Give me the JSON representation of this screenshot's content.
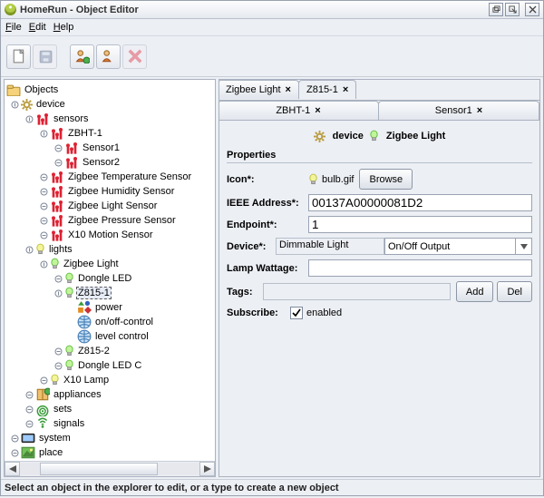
{
  "window": {
    "title": "HomeRun - Object Editor"
  },
  "menu": {
    "file": "File",
    "edit": "Edit",
    "help": "Help"
  },
  "tree": {
    "root": "Objects",
    "device": "device",
    "sensors": "sensors",
    "zbht1": "ZBHT-1",
    "sensor1": "Sensor1",
    "sensor2": "Sensor2",
    "ztemp": "Zigbee Temperature Sensor",
    "zhum": "Zigbee Humidity Sensor",
    "zlight": "Zigbee Light Sensor",
    "zpress": "Zigbee Pressure Sensor",
    "x10motion": "X10 Motion Sensor",
    "lights": "lights",
    "zigbeelight": "Zigbee Light",
    "dongleled": "Dongle LED",
    "z8151": "Z815-1",
    "power": "power",
    "onoff": "on/off-control",
    "level": "level control",
    "z8152": "Z815-2",
    "dongleledc": "Dongle LED C",
    "x10lamp": "X10 Lamp",
    "appliances": "appliances",
    "sets": "sets",
    "signals": "signals",
    "system": "system",
    "place": "place"
  },
  "tabs": {
    "row1": [
      {
        "label": "Zigbee Light",
        "active": false
      },
      {
        "label": "Z815-1",
        "active": true
      }
    ],
    "row2": [
      {
        "label": "ZBHT-1",
        "active": false
      },
      {
        "label": "Sensor1",
        "active": false
      }
    ]
  },
  "crumb": {
    "device": "device",
    "type": "Zigbee Light"
  },
  "props": {
    "title": "Properties",
    "icon_label": "Icon*:",
    "icon_value": "bulb.gif",
    "browse": "Browse",
    "ieee_label": "IEEE Address*:",
    "ieee_value": "00137A00000081D2",
    "endpoint_label": "Endpoint*:",
    "endpoint_value": "1",
    "device_label": "Device*:",
    "device_value": "Dimmable Light",
    "device_dropdown": "On/Off Output",
    "lampw_label": "Lamp Wattage:",
    "lampw_value": "",
    "tags_label": "Tags:",
    "add": "Add",
    "del": "Del",
    "subscribe_label": "Subscribe:",
    "subscribe_text": "enabled",
    "subscribe_checked": true
  },
  "status": "Select an object in the explorer to edit, or a type to create a new object"
}
